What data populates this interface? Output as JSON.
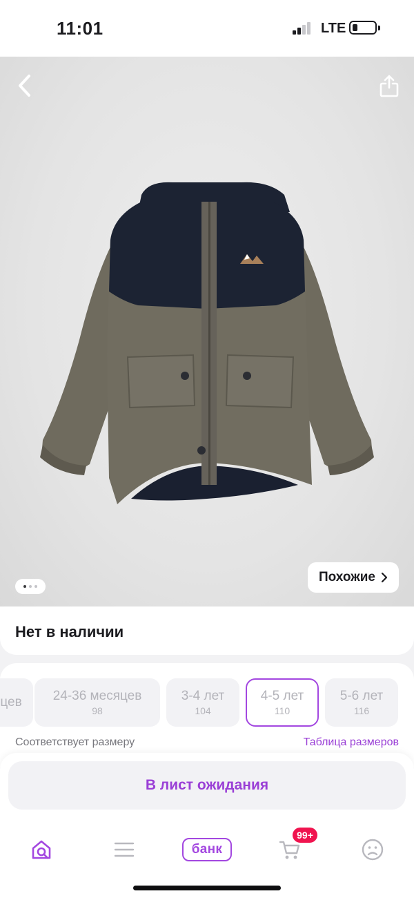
{
  "status_bar": {
    "time": "11:01",
    "network": "LTE"
  },
  "product": {
    "image_description_icon": "jacket-image",
    "similar_label": "Похожие",
    "dots_total": 3,
    "dots_active": 1
  },
  "availability": {
    "text": "Нет в наличии"
  },
  "sizes": {
    "items": [
      {
        "label": "цев",
        "sub": ""
      },
      {
        "label": "24-36 месяцев",
        "sub": "98"
      },
      {
        "label": "3-4 лет",
        "sub": "104"
      },
      {
        "label": "4-5 лет",
        "sub": "110",
        "selected": true
      },
      {
        "label": "5-6 лет",
        "sub": "116"
      }
    ],
    "fit_text": "Соответствует размеру",
    "size_table_link": "Таблица размеров"
  },
  "waitlist": {
    "label": "В лист ожидания"
  },
  "tab_bar": {
    "bank_label": "банк",
    "cart_badge": "99+"
  },
  "colors": {
    "accent": "#a347e0",
    "accent_text": "#9a3fd6",
    "badge": "#f0144f",
    "jacket_body": "#6f6b5e",
    "jacket_yoke": "#1c2333"
  }
}
